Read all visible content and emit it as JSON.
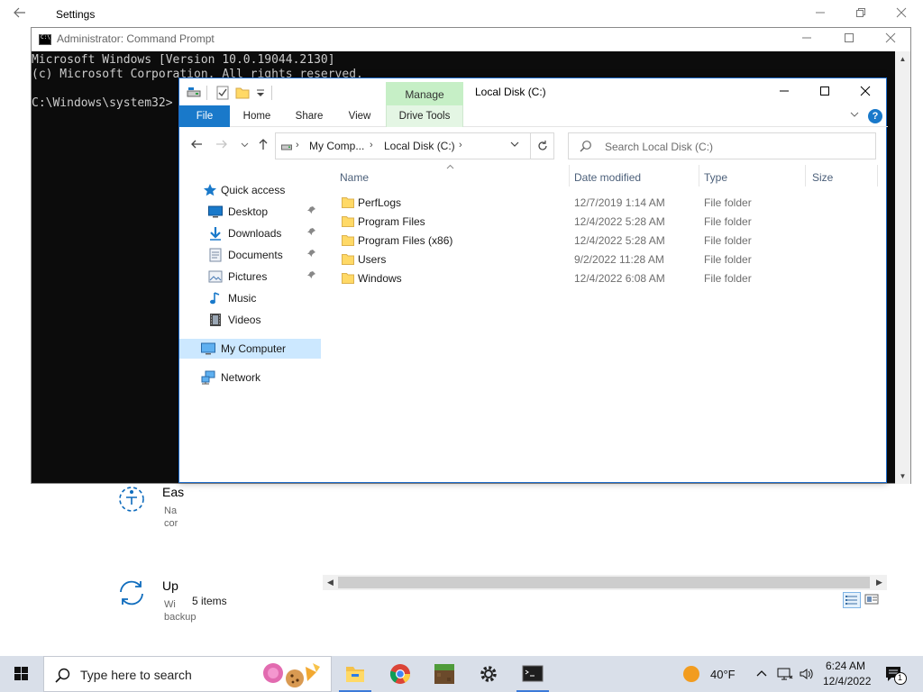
{
  "settings": {
    "title": "Settings",
    "items": [
      {
        "title": "Eas",
        "desc_line1": "Na",
        "desc_line2": "cor"
      },
      {
        "title": "Up",
        "desc_line1": "Wi",
        "desc_line2": "backup"
      }
    ]
  },
  "cmd": {
    "title": "Administrator: Command Prompt",
    "lines": [
      "Microsoft Windows [Version 10.0.19044.2130]",
      "(c) Microsoft Corporation. All rights reserved.",
      "",
      "C:\\Windows\\system32>"
    ]
  },
  "explorer": {
    "title": "Local Disk (C:)",
    "context_tab": "Manage",
    "context_group": "Drive Tools",
    "tabs": [
      "File",
      "Home",
      "Share",
      "View"
    ],
    "help": "?",
    "breadcrumb": [
      "My Comp...",
      "Local Disk (C:)"
    ],
    "search_placeholder": "Search Local Disk (C:)",
    "nav": {
      "quick_access": "Quick access",
      "pinned": [
        "Desktop",
        "Downloads",
        "Documents",
        "Pictures"
      ],
      "other": [
        "Music",
        "Videos"
      ],
      "my_computer": "My Computer",
      "network": "Network"
    },
    "columns": [
      "Name",
      "Date modified",
      "Type",
      "Size"
    ],
    "files": [
      {
        "name": "PerfLogs",
        "date": "12/7/2019 1:14 AM",
        "type": "File folder"
      },
      {
        "name": "Program Files",
        "date": "12/4/2022 5:28 AM",
        "type": "File folder"
      },
      {
        "name": "Program Files (x86)",
        "date": "12/4/2022 5:28 AM",
        "type": "File folder"
      },
      {
        "name": "Users",
        "date": "9/2/2022 11:28 AM",
        "type": "File folder"
      },
      {
        "name": "Windows",
        "date": "12/4/2022 6:08 AM",
        "type": "File folder"
      }
    ],
    "status": "5 items"
  },
  "taskbar": {
    "search_placeholder": "Type here to search",
    "weather": "40°F",
    "time": "6:24 AM",
    "date": "12/4/2022",
    "notification_count": "1"
  },
  "colors": {
    "accent": "#1979ca",
    "manage_tab": "#c6efc6",
    "nav_selected": "#cce8ff",
    "taskbar": "#d9dfe9",
    "folder": "#ffd966"
  }
}
